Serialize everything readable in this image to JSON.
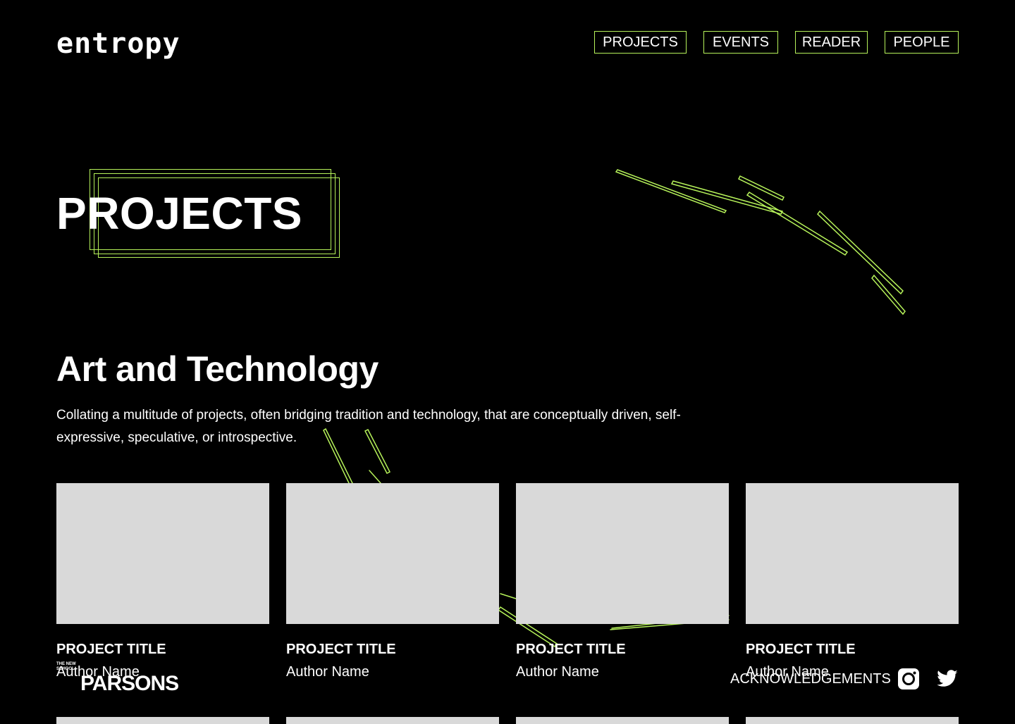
{
  "header": {
    "logo": "entropy",
    "nav": [
      "PROJECTS",
      "EVENTS",
      "READER",
      "PEOPLE"
    ]
  },
  "hero": {
    "title": "PROJECTS"
  },
  "section": {
    "title": "Art and Technology",
    "description": "Collating a multitude of projects, often bridging tradition and technology, that are conceptually driven, self-expressive, speculative, or introspective."
  },
  "projects": [
    {
      "title": "PROJECT TITLE",
      "author": "Author Name"
    },
    {
      "title": "PROJECT TITLE",
      "author": "Author Name"
    },
    {
      "title": "PROJECT TITLE",
      "author": "Author Name"
    },
    {
      "title": "PROJECT TITLE",
      "author": "Author Name"
    }
  ],
  "footer": {
    "school_small": "THE NEW SCHOOL",
    "school": "PARSONS",
    "acknowledgements": "ACKNOWLEDGEMENTS",
    "social": [
      "instagram-icon",
      "twitter-icon"
    ]
  },
  "colors": {
    "background": "#000000",
    "accent": "#b6f25a",
    "placeholder": "#d9d9d9",
    "text": "#ffffff"
  }
}
